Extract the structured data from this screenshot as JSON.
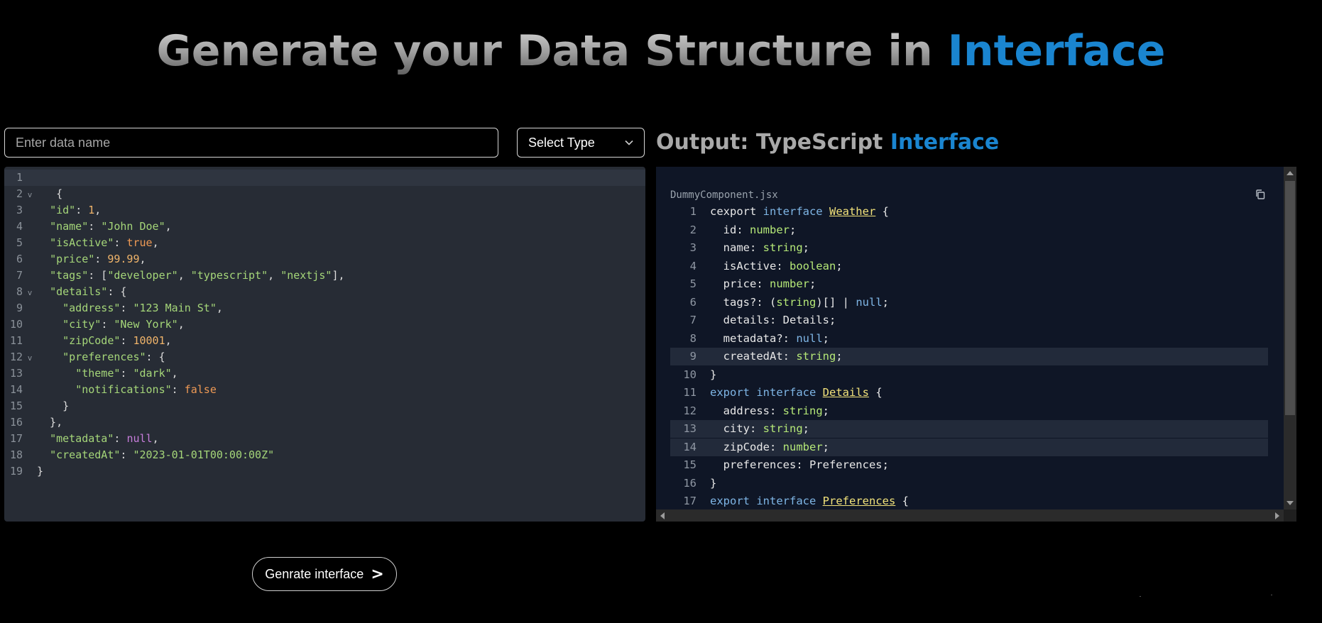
{
  "header": {
    "title_prefix": "Generate your Data Structure in",
    "title_highlight": "Interface"
  },
  "form": {
    "name_placeholder": "Enter data name",
    "name_value": "",
    "select_label": "Select Type",
    "generate_label": "Genrate interface",
    "generate_arrow": ">"
  },
  "output": {
    "title_prefix": "Output: TypeScript",
    "title_highlight": "Interface",
    "file_name": "DummyComponent.jsx"
  },
  "colors": {
    "accent": "#1a85d0",
    "editor_bg": "#272c35",
    "output_bg": "#0f1626"
  },
  "editor_lines": [
    {
      "n": "1",
      "fold": "",
      "tokens": []
    },
    {
      "n": "2",
      "fold": "v",
      "tokens": [
        [
          "p",
          "   {"
        ]
      ]
    },
    {
      "n": "3",
      "fold": "",
      "tokens": [
        [
          "p",
          "  "
        ],
        [
          "k",
          "\"id\""
        ],
        [
          "p",
          ": "
        ],
        [
          "n",
          "1"
        ],
        [
          "p",
          ","
        ]
      ]
    },
    {
      "n": "4",
      "fold": "",
      "tokens": [
        [
          "p",
          "  "
        ],
        [
          "k",
          "\"name\""
        ],
        [
          "p",
          ": "
        ],
        [
          "s",
          "\"John Doe\""
        ],
        [
          "p",
          ","
        ]
      ]
    },
    {
      "n": "5",
      "fold": "",
      "tokens": [
        [
          "p",
          "  "
        ],
        [
          "k",
          "\"isActive\""
        ],
        [
          "p",
          ": "
        ],
        [
          "b",
          "true"
        ],
        [
          "p",
          ","
        ]
      ]
    },
    {
      "n": "6",
      "fold": "",
      "tokens": [
        [
          "p",
          "  "
        ],
        [
          "k",
          "\"price\""
        ],
        [
          "p",
          ": "
        ],
        [
          "n",
          "99.99"
        ],
        [
          "p",
          ","
        ]
      ]
    },
    {
      "n": "7",
      "fold": "",
      "tokens": [
        [
          "p",
          "  "
        ],
        [
          "k",
          "\"tags\""
        ],
        [
          "p",
          ": ["
        ],
        [
          "s",
          "\"developer\""
        ],
        [
          "p",
          ", "
        ],
        [
          "s",
          "\"typescript\""
        ],
        [
          "p",
          ", "
        ],
        [
          "s",
          "\"nextjs\""
        ],
        [
          "p",
          "],"
        ]
      ]
    },
    {
      "n": "8",
      "fold": "v",
      "tokens": [
        [
          "p",
          "  "
        ],
        [
          "k",
          "\"details\""
        ],
        [
          "p",
          ": {"
        ]
      ]
    },
    {
      "n": "9",
      "fold": "",
      "tokens": [
        [
          "p",
          "    "
        ],
        [
          "k",
          "\"address\""
        ],
        [
          "p",
          ": "
        ],
        [
          "s",
          "\"123 Main St\""
        ],
        [
          "p",
          ","
        ]
      ]
    },
    {
      "n": "10",
      "fold": "",
      "tokens": [
        [
          "p",
          "    "
        ],
        [
          "k",
          "\"city\""
        ],
        [
          "p",
          ": "
        ],
        [
          "s",
          "\"New York\""
        ],
        [
          "p",
          ","
        ]
      ]
    },
    {
      "n": "11",
      "fold": "",
      "tokens": [
        [
          "p",
          "    "
        ],
        [
          "k",
          "\"zipCode\""
        ],
        [
          "p",
          ": "
        ],
        [
          "n",
          "10001"
        ],
        [
          "p",
          ","
        ]
      ]
    },
    {
      "n": "12",
      "fold": "v",
      "tokens": [
        [
          "p",
          "    "
        ],
        [
          "k",
          "\"preferences\""
        ],
        [
          "p",
          ": {"
        ]
      ]
    },
    {
      "n": "13",
      "fold": "",
      "tokens": [
        [
          "p",
          "      "
        ],
        [
          "k",
          "\"theme\""
        ],
        [
          "p",
          ": "
        ],
        [
          "s",
          "\"dark\""
        ],
        [
          "p",
          ","
        ]
      ]
    },
    {
      "n": "14",
      "fold": "",
      "tokens": [
        [
          "p",
          "      "
        ],
        [
          "k",
          "\"notifications\""
        ],
        [
          "p",
          ": "
        ],
        [
          "b",
          "false"
        ]
      ]
    },
    {
      "n": "15",
      "fold": "",
      "tokens": [
        [
          "p",
          "    }"
        ]
      ]
    },
    {
      "n": "16",
      "fold": "",
      "tokens": [
        [
          "p",
          "  },"
        ]
      ]
    },
    {
      "n": "17",
      "fold": "",
      "tokens": [
        [
          "p",
          "  "
        ],
        [
          "k",
          "\"metadata\""
        ],
        [
          "p",
          ": "
        ],
        [
          "nl",
          "null"
        ],
        [
          "p",
          ","
        ]
      ]
    },
    {
      "n": "18",
      "fold": "",
      "tokens": [
        [
          "p",
          "  "
        ],
        [
          "k",
          "\"createdAt\""
        ],
        [
          "p",
          ": "
        ],
        [
          "s",
          "\"2023-01-01T00:00:00Z\""
        ]
      ]
    },
    {
      "n": "19",
      "fold": "",
      "tokens": [
        [
          "p",
          "}"
        ]
      ]
    }
  ],
  "output_lines": [
    {
      "n": "1",
      "hl": false,
      "tokens": [
        [
          "ot",
          "cexport "
        ],
        [
          "okw",
          "interface "
        ],
        [
          "oname",
          "Weather"
        ],
        [
          "ot",
          " {"
        ]
      ]
    },
    {
      "n": "2",
      "hl": false,
      "tokens": [
        [
          "ot",
          "  id: "
        ],
        [
          "otype",
          "number"
        ],
        [
          "ot",
          ";"
        ]
      ]
    },
    {
      "n": "3",
      "hl": false,
      "tokens": [
        [
          "ot",
          "  name: "
        ],
        [
          "otype",
          "string"
        ],
        [
          "ot",
          ";"
        ]
      ]
    },
    {
      "n": "4",
      "hl": false,
      "tokens": [
        [
          "ot",
          "  isActive: "
        ],
        [
          "otype",
          "boolean"
        ],
        [
          "ot",
          ";"
        ]
      ]
    },
    {
      "n": "5",
      "hl": false,
      "tokens": [
        [
          "ot",
          "  price: "
        ],
        [
          "otype",
          "number"
        ],
        [
          "ot",
          ";"
        ]
      ]
    },
    {
      "n": "6",
      "hl": false,
      "tokens": [
        [
          "ot",
          "  tags?: ("
        ],
        [
          "otype",
          "string"
        ],
        [
          "ot",
          ")[] | "
        ],
        [
          "onull",
          "null"
        ],
        [
          "ot",
          ";"
        ]
      ]
    },
    {
      "n": "7",
      "hl": false,
      "tokens": [
        [
          "ot",
          "  details: Details;"
        ]
      ]
    },
    {
      "n": "8",
      "hl": false,
      "tokens": [
        [
          "ot",
          "  metadata?: "
        ],
        [
          "onull",
          "null"
        ],
        [
          "ot",
          ";"
        ]
      ]
    },
    {
      "n": "9",
      "hl": true,
      "tokens": [
        [
          "ot",
          "  createdAt: "
        ],
        [
          "otype",
          "string"
        ],
        [
          "ot",
          ";"
        ]
      ]
    },
    {
      "n": "10",
      "hl": false,
      "tokens": [
        [
          "ot",
          "}"
        ]
      ]
    },
    {
      "n": "11",
      "hl": false,
      "tokens": [
        [
          "okw",
          "export "
        ],
        [
          "okw",
          "interface "
        ],
        [
          "oname",
          "Details"
        ],
        [
          "ot",
          " {"
        ]
      ]
    },
    {
      "n": "12",
      "hl": false,
      "tokens": [
        [
          "ot",
          "  address: "
        ],
        [
          "otype",
          "string"
        ],
        [
          "ot",
          ";"
        ]
      ]
    },
    {
      "n": "13",
      "hl": true,
      "tokens": [
        [
          "ot",
          "  city: "
        ],
        [
          "otype",
          "string"
        ],
        [
          "ot",
          ";"
        ]
      ]
    },
    {
      "n": "14",
      "hl": true,
      "tokens": [
        [
          "ot",
          "  zipCode: "
        ],
        [
          "otype",
          "number"
        ],
        [
          "ot",
          ";"
        ]
      ]
    },
    {
      "n": "15",
      "hl": false,
      "tokens": [
        [
          "ot",
          "  preferences: Preferences;"
        ]
      ]
    },
    {
      "n": "16",
      "hl": false,
      "tokens": [
        [
          "ot",
          "}"
        ]
      ]
    },
    {
      "n": "17",
      "hl": false,
      "tokens": [
        [
          "okw",
          "export "
        ],
        [
          "okw",
          "interface "
        ],
        [
          "oname",
          "Preferences"
        ],
        [
          "ot",
          " {"
        ]
      ]
    }
  ]
}
